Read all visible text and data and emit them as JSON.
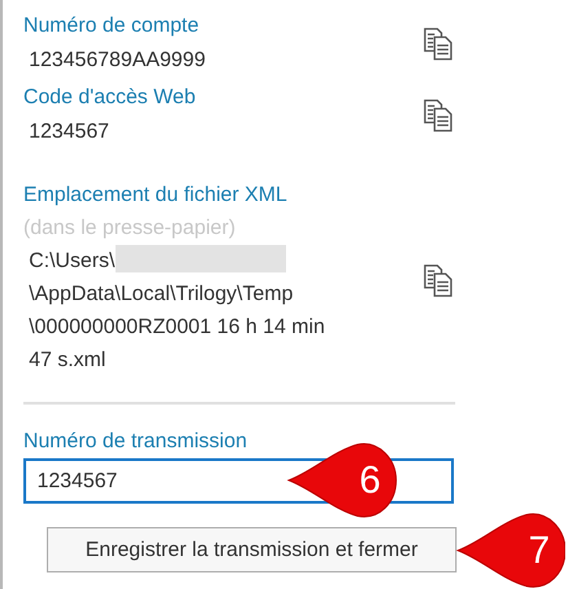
{
  "fields": [
    {
      "label": "Numéro de compte",
      "value_lines": [
        "123456789AA9999"
      ]
    },
    {
      "label": "Code d'accès Web",
      "value_lines": [
        "1234567"
      ]
    }
  ],
  "xml_location": {
    "label": "Emplacement du fichier XML",
    "hint": "(dans le presse-papier)",
    "path_start": "C:\\Users\\",
    "redacted": true,
    "path_lines": [
      "\\AppData\\Local\\Trilogy\\Temp",
      "\\000000000RZ0001 16 h 14 min 47 s.xml"
    ]
  },
  "transmission": {
    "label": "Numéro de transmission",
    "value": "1234567",
    "focused": true
  },
  "button": {
    "label": "Enregistrer la transmission et fermer"
  },
  "callouts": [
    {
      "number": "6"
    },
    {
      "number": "7"
    }
  ]
}
